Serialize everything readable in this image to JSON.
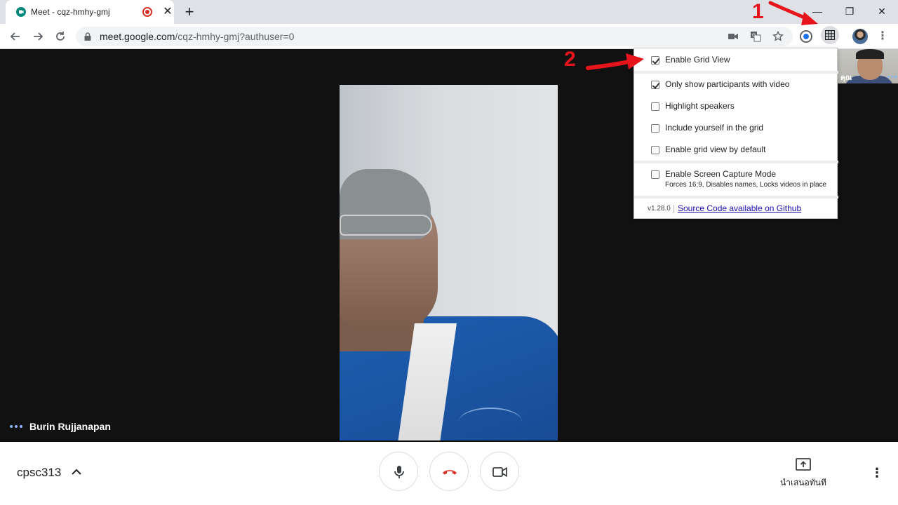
{
  "browser": {
    "tab": {
      "title": "Meet - cqz-hmhy-gmj"
    },
    "url": {
      "host": "meet.google.com",
      "path": "/cqz-hmhy-gmj?authuser=0"
    },
    "window_controls": {
      "minimize": "—",
      "restore": "❐",
      "close": "✕"
    }
  },
  "meet": {
    "speaker_name": "Burin Rujjanapan",
    "self_label": "คุณ",
    "meeting_code": "cpsc313",
    "present_label": "นำเสนอทันที"
  },
  "grid_popup": {
    "options": [
      {
        "label": "Enable Grid View",
        "checked": true
      },
      {
        "label": "Only show participants with video",
        "checked": true
      },
      {
        "label": "Highlight speakers",
        "checked": false
      },
      {
        "label": "Include yourself in the grid",
        "checked": false
      },
      {
        "label": "Enable grid view by default",
        "checked": false
      },
      {
        "label": "Enable Screen Capture Mode",
        "checked": false
      }
    ],
    "capture_mode_note": "Forces 16:9, Disables names, Locks videos in place",
    "version": "v1.28.0",
    "source_link": "Source Code available on Github"
  },
  "annotations": {
    "step1": "1",
    "step2": "2",
    "color": "#e8141b"
  },
  "colors": {
    "stage_bg": "#111111",
    "hangup_red": "#d93025",
    "link": "#1a0dab"
  }
}
